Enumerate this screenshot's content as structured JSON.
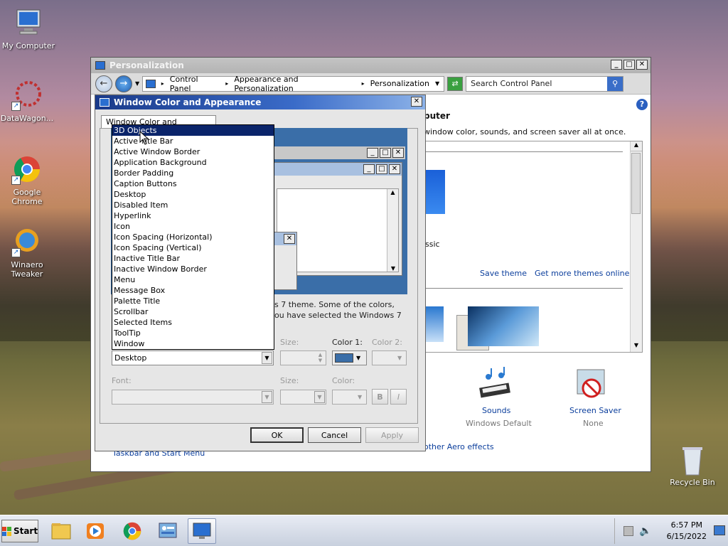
{
  "desktop": {
    "icons": [
      {
        "label": "My Computer"
      },
      {
        "label": "DataWagon..."
      },
      {
        "label": "Google Chrome"
      },
      {
        "label": "Winaero Tweaker"
      },
      {
        "label": "Recycle Bin"
      }
    ]
  },
  "personalization": {
    "title": "Personalization",
    "breadcrumb": [
      "Control Panel",
      "Appearance and Personalization",
      "Personalization"
    ],
    "search_placeholder": "Search Control Panel",
    "heading_fragment": "puter",
    "subtitle_fragment": "window color, sounds, and screen saver all at once.",
    "classic_fragment": "ssic",
    "save_theme": "Save theme",
    "more_themes": "Get more themes online",
    "sounds": {
      "label": "Sounds",
      "value": "Windows Default"
    },
    "screen_saver": {
      "label": "Screen Saver",
      "value": "None"
    },
    "aero_fragment": "other Aero effects",
    "taskbar_link": "Taskbar and Start Menu"
  },
  "dialog": {
    "title": "Window Color and Appearance",
    "tab_label": "Window Color and Appearance",
    "note_line1": "s 7 theme.  Some of the colors,",
    "note_line2": "ou have selected the Windows 7",
    "item_label": "Item:",
    "item_value": "Desktop",
    "size_label": "Size:",
    "color1_label": "Color 1:",
    "color2_label": "Color 2:",
    "font_label": "Font:",
    "font_size_label": "Size:",
    "font_color_label": "Color:",
    "bold_label": "B",
    "italic_label": "I",
    "ok": "OK",
    "cancel": "Cancel",
    "apply": "Apply",
    "color1_value": "#3a6ea8",
    "dropdown_items": [
      "3D Objects",
      "Active Title Bar",
      "Active Window Border",
      "Application Background",
      "Border Padding",
      "Caption Buttons",
      "Desktop",
      "Disabled Item",
      "Hyperlink",
      "Icon",
      "Icon Spacing (Horizontal)",
      "Icon Spacing (Vertical)",
      "Inactive Title Bar",
      "Inactive Window Border",
      "Menu",
      "Message Box",
      "Palette Title",
      "Scrollbar",
      "Selected Items",
      "ToolTip",
      "Window"
    ],
    "selected_index": 0
  },
  "taskbar": {
    "start": "Start",
    "time": "6:57 PM",
    "date": "6/15/2022"
  }
}
